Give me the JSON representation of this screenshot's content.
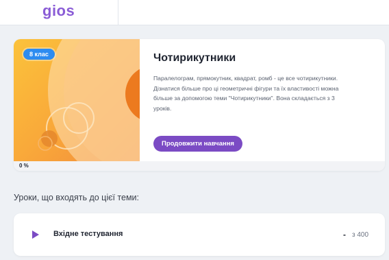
{
  "header": {
    "logo_text": "gios",
    "brand_color": "#8a5cd6"
  },
  "topic": {
    "grade_badge": "8 клас",
    "title": "Чотирикутники",
    "description": "Паралелограм, прямокутник, квадрат, ромб - це все чотирикутники. Дізнатися більше про ці геометричні фігури та їх властивості можна більше за допомогою теми \"Чотирикутники\". Вона складається з 3 уроків.",
    "continue_label": "Продовжити навчання",
    "progress_label": "0 %",
    "progress_value": 0,
    "accent_color": "#7b4bc4",
    "badge_color": "#2d8cf0",
    "hero_icon": "concentric-circles-illustration"
  },
  "lessons_section": {
    "heading": "Уроки, що входять до цієї теми:",
    "items": [
      {
        "icon": "play-icon",
        "title": "Вхідне тестування",
        "score": "-",
        "max_score": "з 400"
      }
    ]
  }
}
